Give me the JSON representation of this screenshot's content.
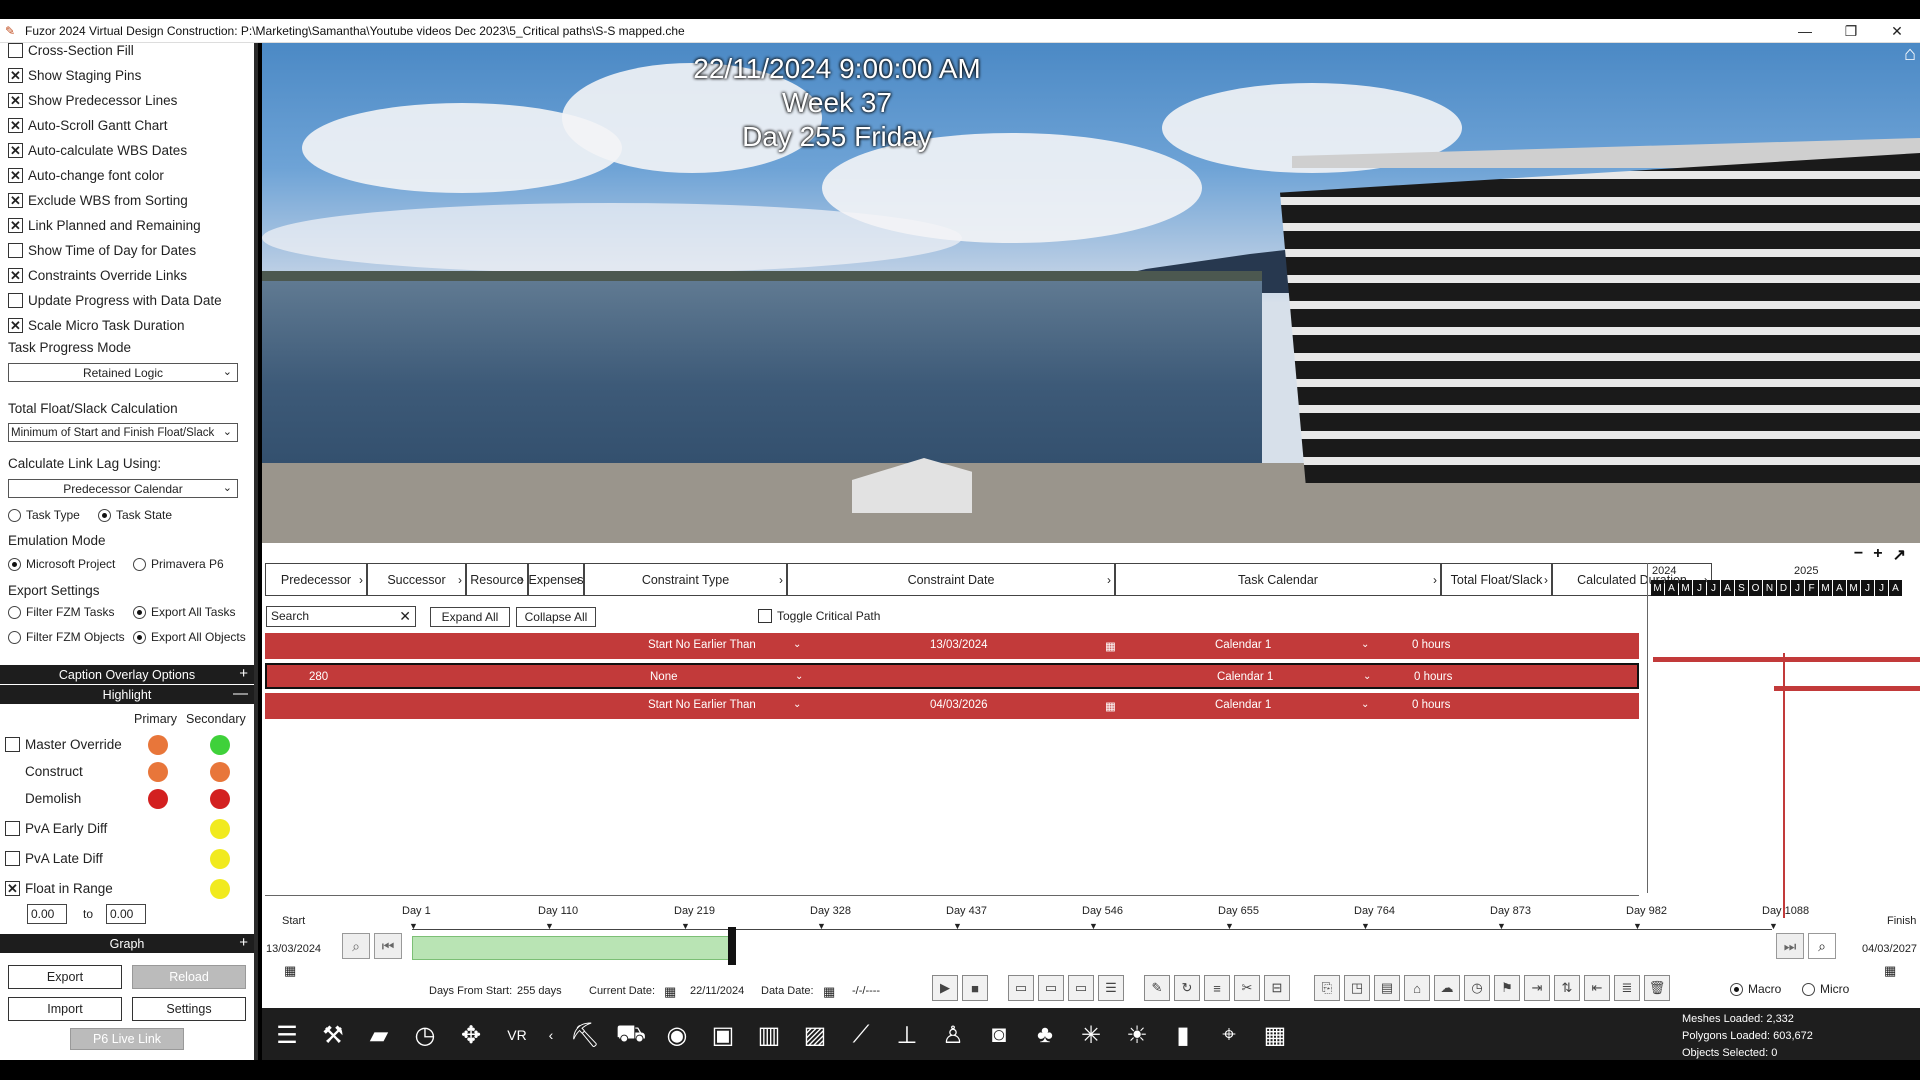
{
  "window": {
    "title": "Fuzor 2024 Virtual Design Construction: P:\\Marketing\\Samantha\\Youtube videos Dec 2023\\5_Critical paths\\S-S mapped.che",
    "minimize": "—",
    "restore": "❐",
    "close": "✕"
  },
  "settings": {
    "checkboxes": [
      {
        "label": "Cross-Section Fill",
        "checked": false
      },
      {
        "label": "Show Staging Pins",
        "checked": true
      },
      {
        "label": "Show Predecessor Lines",
        "checked": true
      },
      {
        "label": "Auto-Scroll Gantt Chart",
        "checked": true
      },
      {
        "label": "Auto-calculate WBS Dates",
        "checked": true
      },
      {
        "label": "Auto-change font color",
        "checked": true
      },
      {
        "label": "Exclude WBS from Sorting",
        "checked": true
      },
      {
        "label": "Link Planned and Remaining",
        "checked": true
      },
      {
        "label": "Show Time of Day for Dates",
        "checked": false
      },
      {
        "label": "Constraints Override Links",
        "checked": true
      },
      {
        "label": "Update Progress with Data Date",
        "checked": false
      },
      {
        "label": "Scale Micro Task Duration",
        "checked": true
      }
    ],
    "task_progress_mode_label": "Task Progress Mode",
    "task_progress_mode_value": "Retained Logic",
    "total_float_label": "Total Float/Slack Calculation",
    "total_float_value": "Minimum of Start and Finish Float/Slack",
    "link_lag_label": "Calculate Link Lag Using:",
    "link_lag_value": "Predecessor Calendar",
    "radio_task_type": "Task Type",
    "radio_task_state": "Task State",
    "emulation_label": "Emulation Mode",
    "radio_ms_project": "Microsoft Project",
    "radio_primavera": "Primavera P6",
    "export_settings_label": "Export Settings",
    "radio_filter_fzm_tasks": "Filter FZM Tasks",
    "radio_export_all_tasks": "Export All Tasks",
    "radio_filter_fzm_objects": "Filter FZM Objects",
    "radio_export_all_objects": "Export All Objects"
  },
  "sections": {
    "caption_overlay": "Caption Overlay Options",
    "highlight": "Highlight",
    "graph": "Graph",
    "plus": "+",
    "minus": "—"
  },
  "highlight": {
    "primary_header": "Primary",
    "secondary_header": "Secondary",
    "master_override": "Master Override",
    "construct": "Construct",
    "demolish": "Demolish",
    "pva_early": "PvA Early Diff",
    "pva_late": "PvA Late Diff",
    "float_range": "Float in Range",
    "range_from": "0.00",
    "range_to_label": "to",
    "range_to": "0.00",
    "colors": {
      "orange": "#e8763a",
      "green": "#3fd13a",
      "red": "#d32020",
      "yellow": "#f1ea1e"
    }
  },
  "buttons": {
    "export": "Export",
    "reload": "Reload",
    "import": "Import",
    "settings": "Settings",
    "p6_live_link": "P6 Live Link"
  },
  "viewport": {
    "date": "22/11/2024 9:00:00 AM",
    "week": "Week 37",
    "day": "Day 255 Friday"
  },
  "grid": {
    "columns": [
      "Predecessor",
      "Successor",
      "Resource",
      "Expenses",
      "Constraint Type",
      "Constraint Date",
      "Task Calendar",
      "Total Float/Slack",
      "Calculated Duration"
    ],
    "search_placeholder": "Search",
    "expand_all": "Expand All",
    "collapse_all": "Collapse All",
    "toggle_critical": "Toggle Critical Path",
    "rows": [
      {
        "pred": "",
        "constraint": "Start No Earlier Than",
        "date": "13/03/2024",
        "calendar": "Calendar 1",
        "float": "0 hours"
      },
      {
        "pred": "280",
        "constraint": "None",
        "date": "",
        "calendar": "Calendar 1",
        "float": "0 hours"
      },
      {
        "pred": "",
        "constraint": "Start No Earlier Than",
        "date": "04/03/2026",
        "calendar": "Calendar 1",
        "float": "0 hours"
      }
    ],
    "accent": "#c23a3a"
  },
  "gantt": {
    "year_2024": "2024",
    "year_2025": "2025",
    "months": [
      "M",
      "A",
      "M",
      "J",
      "J",
      "A",
      "S",
      "O",
      "N",
      "D",
      "J",
      "F",
      "M",
      "A",
      "M",
      "J",
      "J",
      "A"
    ]
  },
  "timeline": {
    "start_label": "Start",
    "finish_label": "Finish",
    "start_date": "13/03/2024",
    "finish_date": "04/03/2027",
    "days": [
      "Day 1",
      "Day 110",
      "Day 219",
      "Day 328",
      "Day 437",
      "Day 546",
      "Day 655",
      "Day 764",
      "Day 873",
      "Day 982",
      "Day 1088"
    ],
    "days_from_start_label": "Days From Start:",
    "days_from_start": "255 days",
    "current_date_label": "Current Date:",
    "current_date": "22/11/2024",
    "data_date_label": "Data Date:",
    "data_date": "-/-/----",
    "macro": "Macro",
    "micro": "Micro"
  },
  "stats": {
    "meshes": "Meshes Loaded: 2,332",
    "polygons": "Polygons Loaded: 603,672",
    "objects": "Objects Selected: 0"
  }
}
